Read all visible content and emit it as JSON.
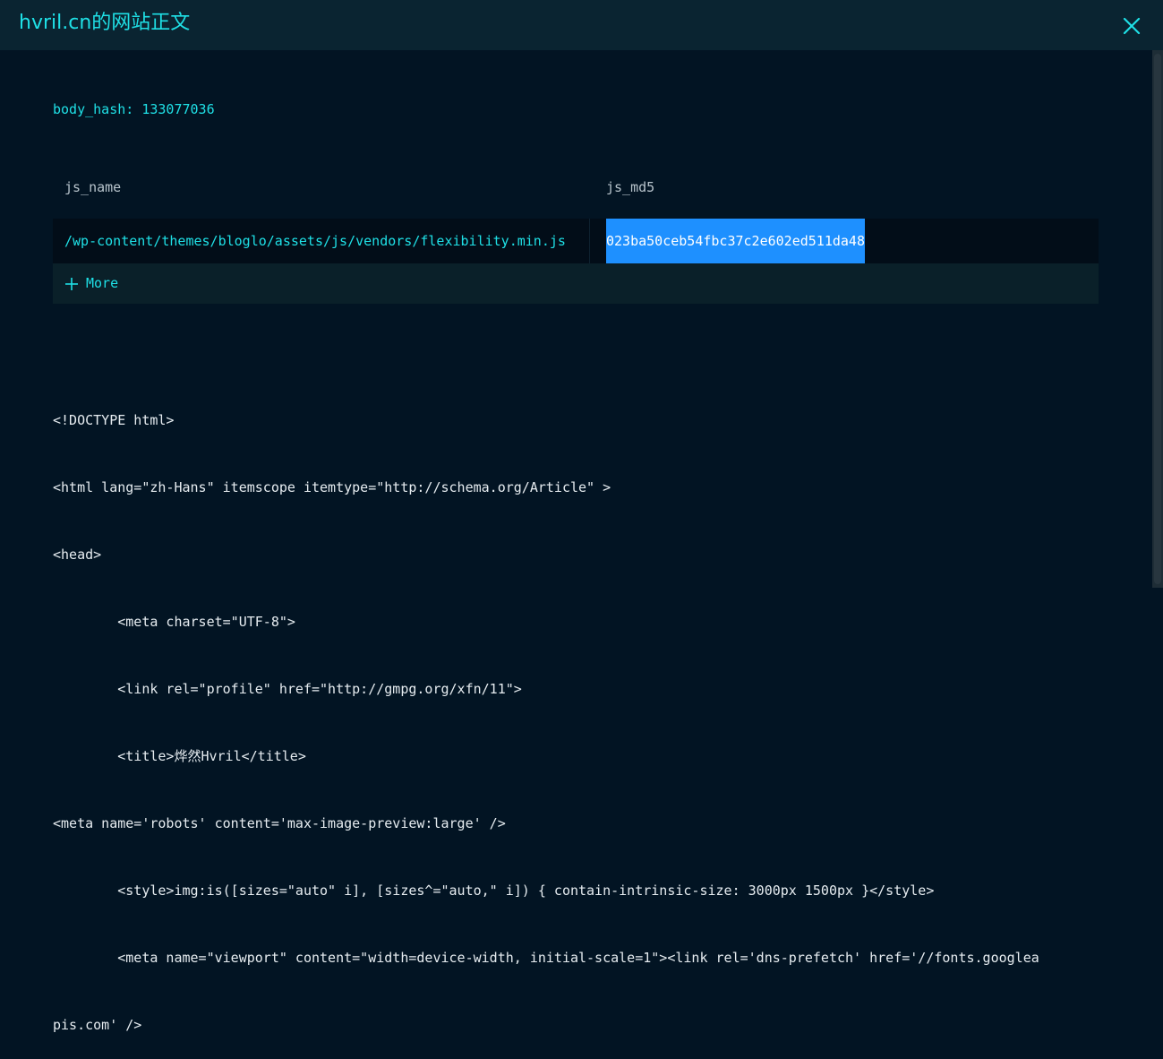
{
  "header": {
    "title": "hvril.cn的网站正文",
    "close_icon": "close-icon"
  },
  "body_hash": "body_hash: 133077036",
  "table": {
    "columns": [
      "js_name",
      "js_md5"
    ],
    "rows": [
      {
        "js_name": "/wp-content/themes/bloglo/assets/js/vendors/flexibility.min.js",
        "js_md5": "023ba50ceb54fbc37c2e602ed511da48"
      }
    ],
    "more_label": "More"
  },
  "code_lines": [
    "<!DOCTYPE html>",
    "<html lang=\"zh-Hans\" itemscope itemtype=\"http://schema.org/Article\" >",
    "<head>",
    "        <meta charset=\"UTF-8\">",
    "        <link rel=\"profile\" href=\"http://gmpg.org/xfn/11\">",
    "        <title>烨然Hvril</title>",
    "<meta name='robots' content='max-image-preview:large' />",
    "        <style>img:is([sizes=\"auto\" i], [sizes^=\"auto,\" i]) { contain-intrinsic-size: 3000px 1500px }</style>",
    "        <meta name=\"viewport\" content=\"width=device-width, initial-scale=1\"><link rel='dns-prefetch' href='//fonts.googlea",
    "pis.com' />"
  ],
  "colors": {
    "background": "#021423",
    "accent": "#1fe0e6",
    "selection": "#1e90ff"
  }
}
